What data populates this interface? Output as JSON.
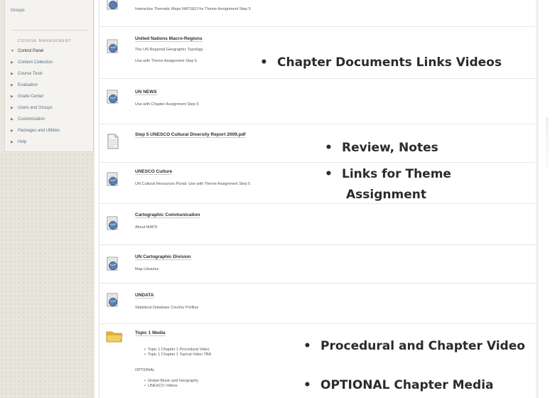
{
  "sidebar": {
    "groups_link": "Groups",
    "heading": "COURSE MANAGEMENT",
    "items": [
      {
        "label": "Control Panel"
      },
      {
        "label": "Content Collection"
      },
      {
        "label": "Course Tools"
      },
      {
        "label": "Evaluation"
      },
      {
        "label": "Grade Center"
      },
      {
        "label": "Users and Groups"
      },
      {
        "label": "Customization"
      },
      {
        "label": "Packages and Utilities"
      },
      {
        "label": "Help"
      }
    ]
  },
  "content": {
    "top_line": "Interactive Thematic Maps NATGEO for Theme Assignment Step 5",
    "items": [
      {
        "title": "United Nations Macro-Regions",
        "lines": [
          "The UN Regional Geographic Typology",
          "Use with Theme Assignment Step 5"
        ]
      },
      {
        "title": "UN NEWS",
        "lines": [
          "Use with Chapter Assignment Step 5"
        ]
      },
      {
        "title": "Step 5 UNESCO Cultural Diversity Report 2009.pdf",
        "lines": []
      },
      {
        "title": "UNESCO Culture",
        "lines": [
          "UN Cultural Resources Portal. Use with Theme Assignment Step 5"
        ]
      },
      {
        "title": "Cartographic Communication",
        "lines": [
          "About MAPS"
        ]
      },
      {
        "title": "UN Cartographic Division",
        "lines": [
          "Map Libraries"
        ]
      },
      {
        "title": "UNDATA",
        "lines": [
          "Statistical Database Country Profiles"
        ]
      },
      {
        "title": "Topic 1 Media",
        "lines": [
          "Topic 1 Chapter 1 Procedural Video",
          "Topic 1 Chapter 1 Topical Video TBA"
        ],
        "optional_label": "OPTIONAL",
        "optional_lines": [
          "Global Music and Geography",
          "UNESCO Videos"
        ]
      }
    ]
  },
  "callouts": {
    "bullet": "•",
    "c1": "Chapter  Documents Links Videos",
    "c2": "Review, Notes",
    "c3a": "Links for Theme",
    "c3b": "Assignment",
    "c4": "Procedural and Chapter Video",
    "c5": "OPTIONAL Chapter Media"
  }
}
